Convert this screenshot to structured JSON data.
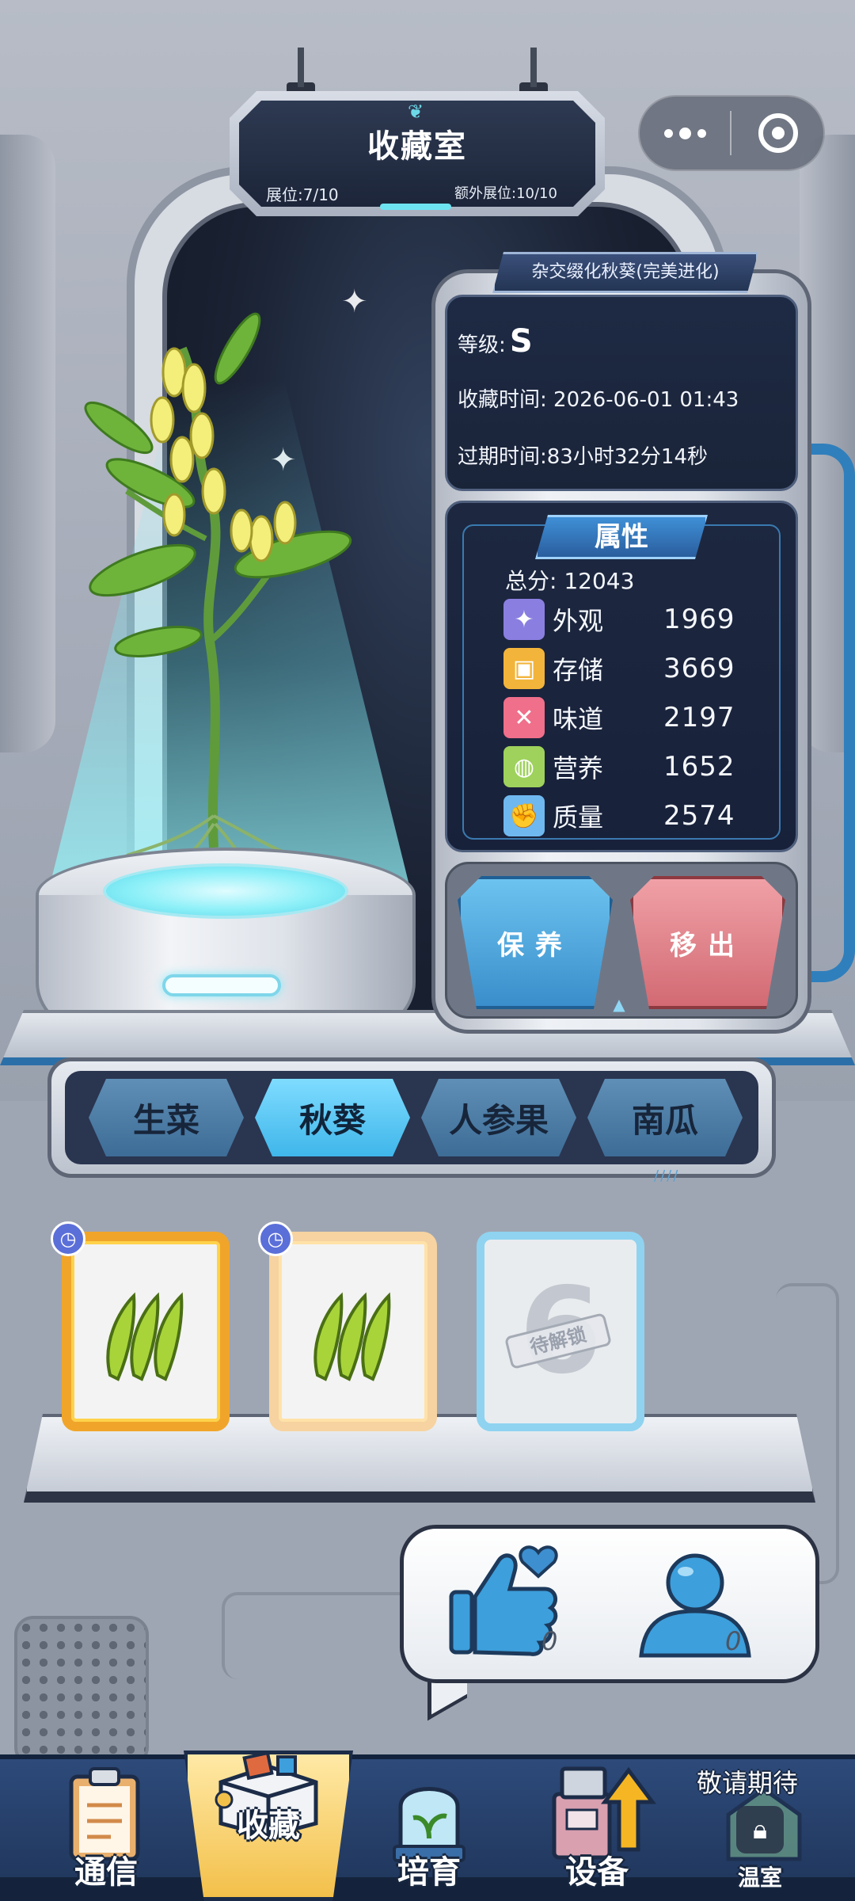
{
  "header": {
    "title": "收藏室",
    "slots": "展位:7/10",
    "extra_slots": "额外展位:10/10"
  },
  "capsule": {
    "more_icon": "more-dots-icon",
    "close_icon": "target-icon"
  },
  "plant": {
    "name": "杂交缀化秋葵(完美进化)",
    "grade_label": "等级:",
    "grade": "S",
    "collected_time": "收藏时间: 2026-06-01 01:43",
    "expire_time": "过期时间:83小时32分14秒"
  },
  "attributes": {
    "title": "属性",
    "total": "总分: 12043",
    "items": [
      {
        "name": "外观",
        "value": "1969",
        "icon": "sparkle-icon",
        "color": "#8a7fe0"
      },
      {
        "name": "存储",
        "value": "3669",
        "icon": "box-icon",
        "color": "#f2b43a"
      },
      {
        "name": "味道",
        "value": "2197",
        "icon": "utensils-icon",
        "color": "#f06f8a"
      },
      {
        "name": "营养",
        "value": "1652",
        "icon": "lemon-icon",
        "color": "#9ed25c"
      },
      {
        "name": "质量",
        "value": "2574",
        "icon": "muscle-icon",
        "color": "#6fb8ef"
      }
    ]
  },
  "actions": {
    "care": "保养",
    "remove": "移出"
  },
  "categories": [
    {
      "label": "生菜",
      "active": false
    },
    {
      "label": "秋葵",
      "active": true
    },
    {
      "label": "人参果",
      "active": false
    },
    {
      "label": "南瓜",
      "active": false
    }
  ],
  "cards": [
    {
      "type": "okra",
      "frame": "gold"
    },
    {
      "type": "okra",
      "frame": "gold"
    },
    {
      "type": "locked",
      "number": "6",
      "badge": "待解锁"
    }
  ],
  "social": {
    "likes": "0",
    "visitors": "0"
  },
  "nav": {
    "items": [
      {
        "label": "通信",
        "icon": "clipboard-icon"
      },
      {
        "label": "收藏",
        "icon": "collection-box-icon",
        "active": true
      },
      {
        "label": "培育",
        "icon": "terrarium-icon"
      },
      {
        "label": "设备",
        "icon": "machine-upgrade-icon"
      },
      {
        "label": "温室",
        "icon": "greenhouse-icon",
        "locked": true
      }
    ],
    "coming_soon": "敬请期待"
  },
  "colors": {
    "accent": "#3fb6ea",
    "danger": "#d26a73",
    "panel_dark": "#1e2a44",
    "gold": "#f0a52a"
  }
}
